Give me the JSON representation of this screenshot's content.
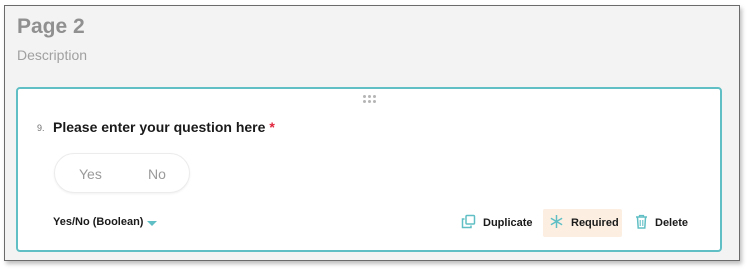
{
  "page": {
    "title": "Page 2",
    "description": "Description"
  },
  "question": {
    "number": "9.",
    "title": "Please enter your question here",
    "required_marker": "*",
    "options": {
      "yes_label": "Yes",
      "no_label": "No"
    },
    "type_label": "Yes/No (Boolean)"
  },
  "actions": {
    "duplicate_label": "Duplicate",
    "required_label": "Required",
    "delete_label": "Delete"
  },
  "icons": {
    "drag": "drag-handle-icon",
    "type_dropdown": "chevron-down-icon",
    "duplicate": "duplicate-icon",
    "required": "asterisk-icon",
    "delete": "trash-icon"
  },
  "colors": {
    "accent": "#60bfc4",
    "required_star": "#e0243c",
    "required_highlight": "#fcefe2"
  }
}
